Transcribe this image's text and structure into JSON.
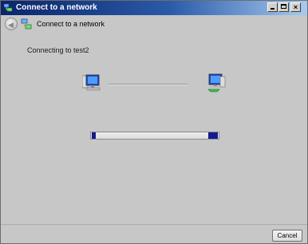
{
  "window": {
    "title": "Connect to a network",
    "controls": {
      "minimize_icon": "minimize-icon",
      "maximize_icon": "maximize-icon",
      "close_glyph": "×"
    }
  },
  "navbar": {
    "back_icon": "back-arrow-icon",
    "network_icon": "network-icon",
    "title": "Connect to a network"
  },
  "main": {
    "status_text": "Connecting to test2",
    "source_icon": "computer-icon",
    "destination_icon": "network-computer-icon",
    "progress": {
      "state": "indeterminate",
      "color": "#141a8e"
    }
  },
  "footer": {
    "cancel_label": "Cancel"
  },
  "colors": {
    "title_gradient_start": "#0a246a",
    "title_gradient_end": "#a6caf0",
    "body_background": "#c7c7c7"
  }
}
